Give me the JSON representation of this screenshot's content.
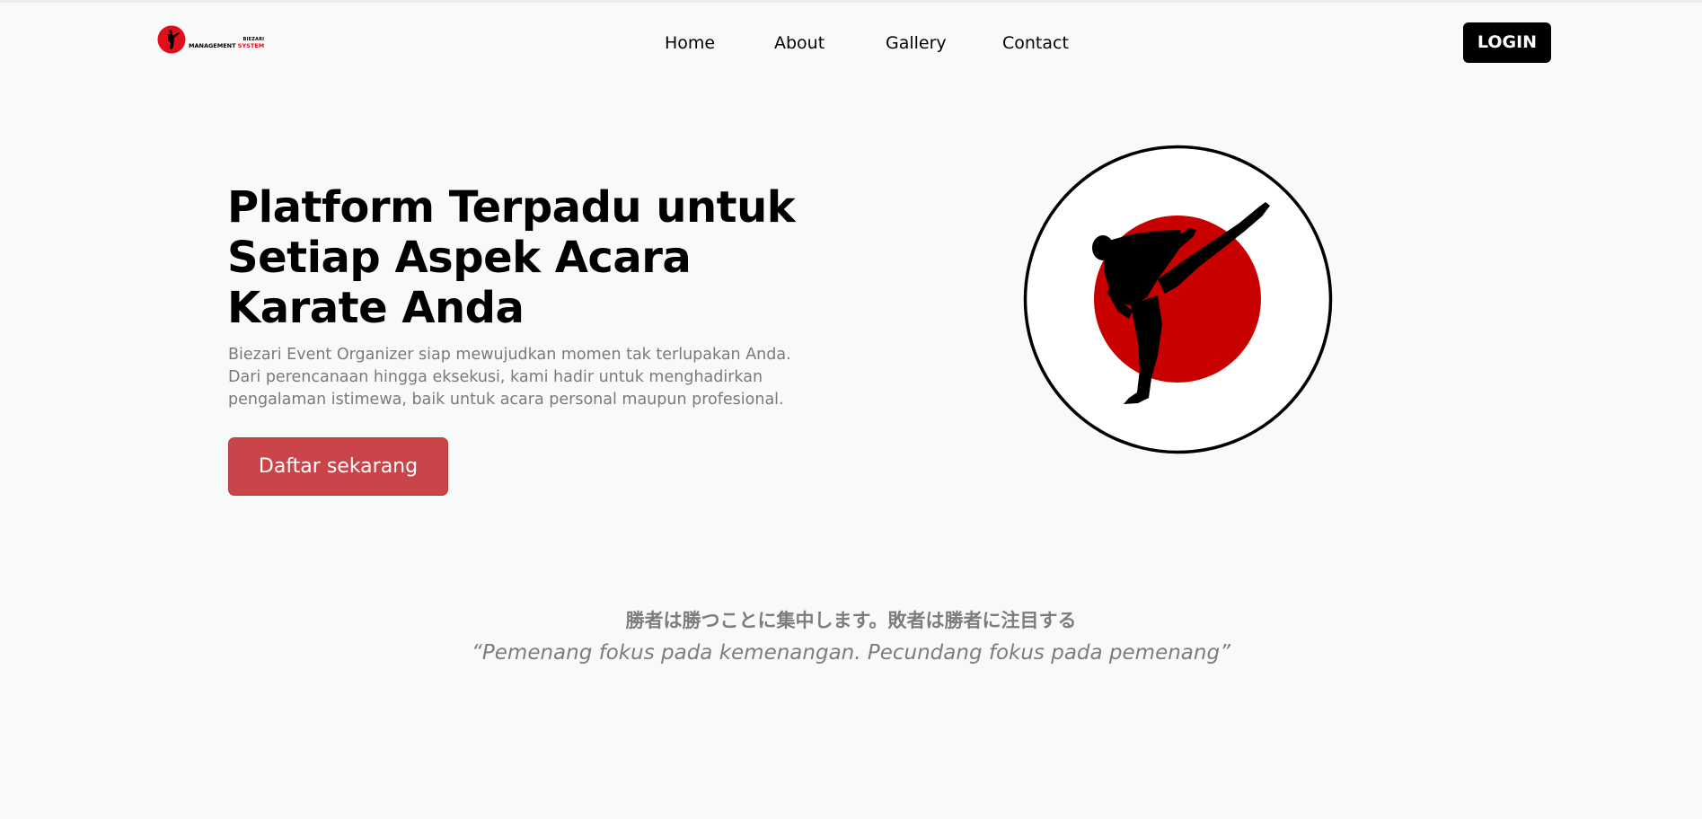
{
  "header": {
    "logo": {
      "brand": "BIEZARI",
      "sub_main": "MANAGEMENT",
      "sub_accent": "SYSTEM"
    },
    "nav": [
      {
        "label": "Home"
      },
      {
        "label": "About"
      },
      {
        "label": "Gallery"
      },
      {
        "label": "Contact"
      }
    ],
    "login_label": "LOGIN"
  },
  "hero": {
    "title": "Platform Terpadu untuk Setiap Aspek Acara Karate Anda",
    "description": "Biezari Event Organizer siap mewujudkan momen tak terlupakan Anda. Dari perencanaan hingga eksekusi, kami hadir untuk menghadirkan pengalaman istimewa, baik untuk acara personal maupun profesional.",
    "cta_label": "Daftar sekarang",
    "emblem_icon": "karate-kick-icon"
  },
  "quote": {
    "japanese": "勝者は勝つことに集中します。敗者は勝者に注目する",
    "translation": "“Pemenang fokus pada kemenangan. Pecundang fokus pada pemenang”"
  },
  "colors": {
    "accent_red": "#c80000",
    "cta_red": "#c9454a",
    "text_muted": "#7a7a7a",
    "background": "#f8f9f9"
  }
}
